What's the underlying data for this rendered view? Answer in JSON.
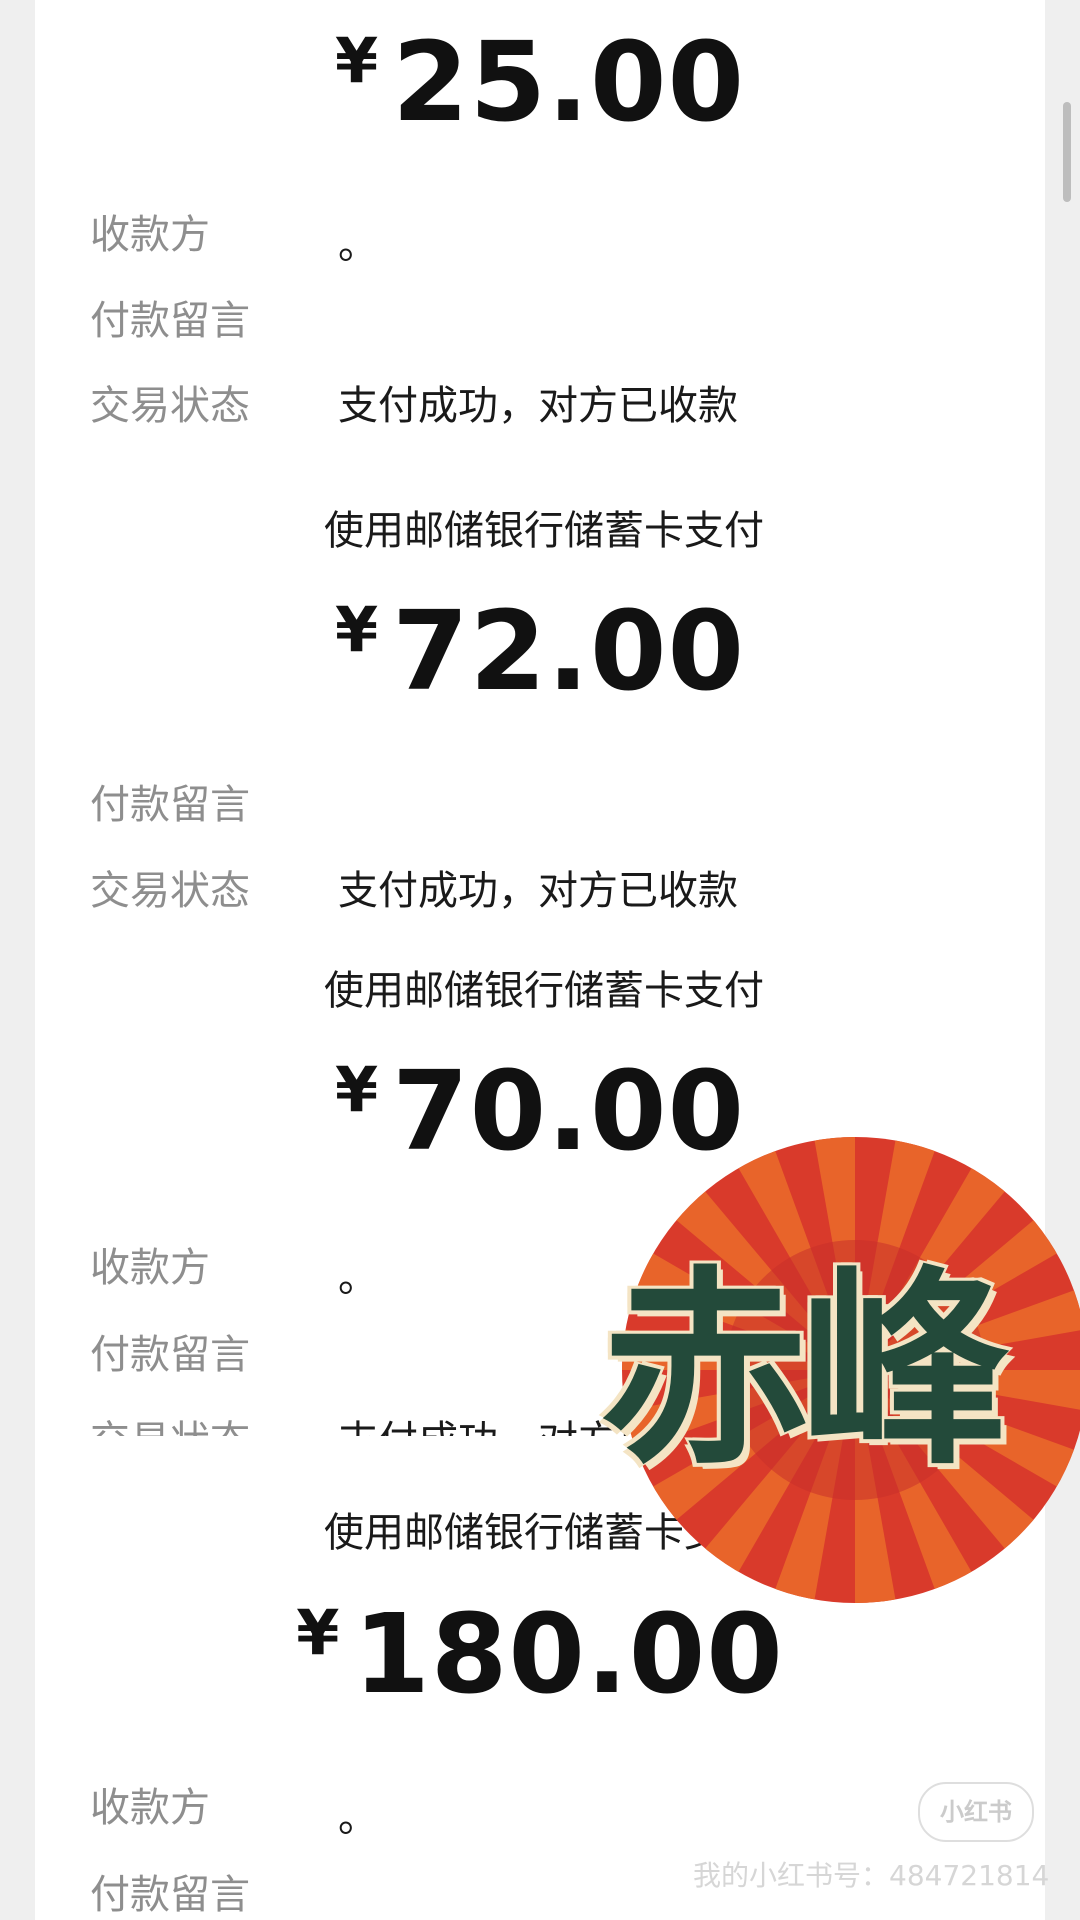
{
  "records": [
    {
      "amount": "25.00",
      "rows": [
        {
          "label": "收款方",
          "value": "。"
        },
        {
          "label": "付款留言",
          "value": ""
        },
        {
          "label": "交易状态",
          "value": "支付成功，对方已收款"
        }
      ],
      "method": "使用邮储银行储蓄卡支付"
    },
    {
      "amount": "72.00",
      "rows": [
        {
          "label": "付款留言",
          "value": ""
        },
        {
          "label": "交易状态",
          "value": "支付成功，对方已收款"
        }
      ],
      "method": "使用邮储银行储蓄卡支付"
    },
    {
      "amount": "70.00",
      "rows": [
        {
          "label": "收款方",
          "value": "。"
        },
        {
          "label": "付款留言",
          "value": ""
        },
        {
          "label": "交易状态",
          "value": "支付成功，对方已收款"
        }
      ],
      "method": "使用邮储银行储蓄卡支付"
    },
    {
      "amount": "180.00",
      "rows": [
        {
          "label": "收款方",
          "value": "。"
        },
        {
          "label": "付款留言",
          "value": ""
        }
      ]
    }
  ],
  "currency_symbol": "¥",
  "sticker": {
    "text": "赤峰",
    "colors": {
      "outer": "#d93a2b",
      "ray": "#e8642a",
      "text": "#234a3a",
      "outline": "#f4e4c4"
    }
  },
  "watermark": {
    "logo": "小红书",
    "id_text": "我的小红书号：484721814"
  }
}
